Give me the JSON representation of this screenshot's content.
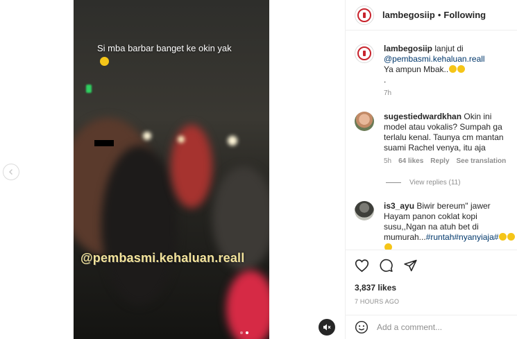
{
  "post": {
    "username": "lambegosiip",
    "follow_status": "Following",
    "separator": "•"
  },
  "media": {
    "overlay_caption": "Si mba barbar banget ke okin yak",
    "watermark": "@pembasmi.kehaluan.reall",
    "carousel_dots": 2,
    "active_dot": 1
  },
  "comments": [
    {
      "username": "lambegosiip",
      "text_before": "lanjut di",
      "mention": "@pembasmi.kehaluan.reall",
      "text_after": "Ya ampun Mbak..",
      "extra_line": ".",
      "time": "7h"
    },
    {
      "username": "sugestiedwardkhan",
      "text": "Okin ini model atau vokalis? Sumpah ga terlalu kenal. Taunya cm mantan suami Rachel venya, itu aja",
      "time": "5h",
      "likes": "64 likes",
      "reply": "Reply",
      "translate": "See translation",
      "view_replies": "View replies (11)"
    },
    {
      "username": "is3_ayu",
      "text": "Biwir bereum\" jawer Hayam panon coklat kopi susu,,Ngan na atuh bet di mumurah...",
      "hashtags": "#runtah#nyanyiaja#"
    }
  ],
  "stats": {
    "likes": "3,837 likes",
    "posted": "7 HOURS AGO"
  },
  "composer": {
    "placeholder": "Add a comment..."
  },
  "icons": {
    "like": "heart-icon",
    "comment": "comment-bubble-icon",
    "share": "paper-plane-icon",
    "emoji": "smiley-icon",
    "mute": "speaker-muted-icon",
    "prev": "chevron-left-icon"
  }
}
